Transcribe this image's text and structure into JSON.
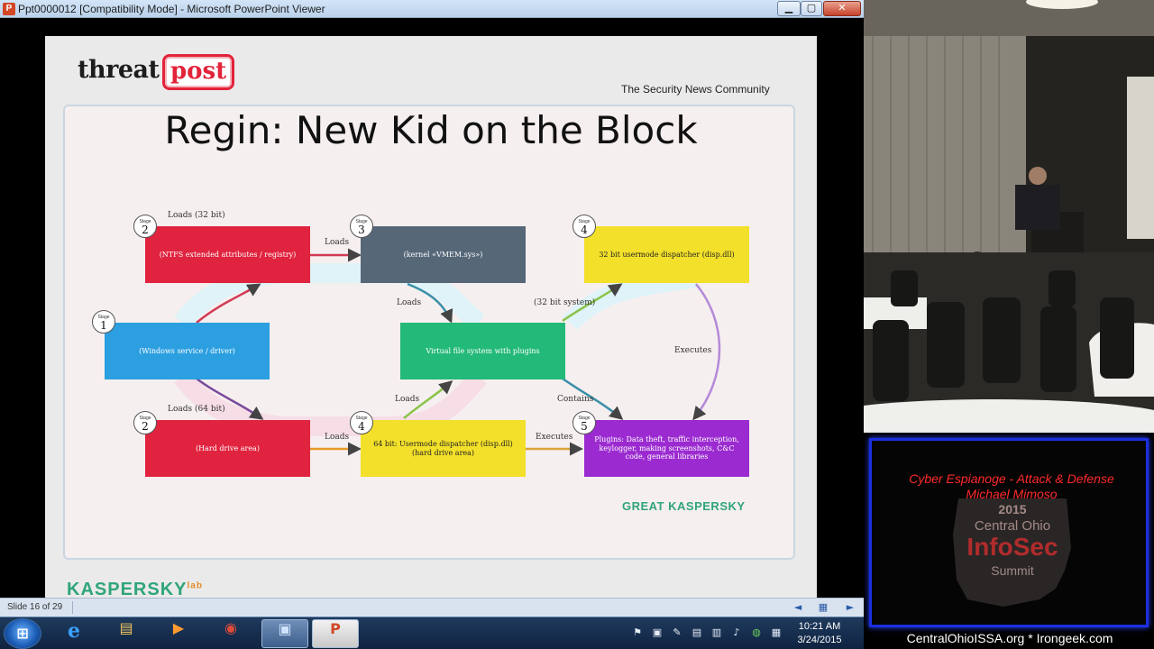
{
  "window": {
    "app_icon": "P",
    "title": "Ppt0000012 [Compatibility Mode] - Microsoft PowerPoint Viewer",
    "min_glyph": "▁",
    "max_glyph": "▢",
    "close_glyph": "✕"
  },
  "slide": {
    "logo_threat": "threat",
    "logo_post": "post",
    "tagline": "The Security News Community",
    "title": "Regin: New Kid on the Block",
    "footer_brand": "KASPERSKY",
    "footer_brand_sup": "lab"
  },
  "diagram": {
    "nodes": [
      {
        "label": "(Windows service / driver)",
        "color": "#2c9fe0"
      },
      {
        "label": "(NTFS extended attributes / registry)",
        "color": "#e0233e"
      },
      {
        "label": "(Hard drive area)",
        "color": "#e0233e"
      },
      {
        "label": "(kernel «VMEM.sys»)",
        "color": "#566778"
      },
      {
        "label": "Virtual file system with plugins",
        "color": "#23b978"
      },
      {
        "label": "64 bit: Usermode dispatcher (disp.dll) (hard drive area)",
        "color": "#f3e02a"
      },
      {
        "label": "32 bit usermode dispatcher (disp.dll)",
        "color": "#f3e02a"
      },
      {
        "label": "Plugins: Data theft, traffic interception, keylogger, making screenshots, C&C code, general libraries",
        "color": "#9b2bd0"
      }
    ],
    "stages": {
      "label": "Stage",
      "one": "1",
      "two_top": "2",
      "two_bottom": "2",
      "three": "3",
      "four_top": "4",
      "four_bottom": "4",
      "five": "5"
    },
    "edge_labels": {
      "loads_32": "Loads (32 bit)",
      "loads_64": "Loads (64 bit)",
      "loads_a": "Loads",
      "loads_b": "Loads",
      "loads_c": "Loads",
      "loads_d": "Loads",
      "system_32": "(32 bit system)",
      "contains": "Contains",
      "executes_a": "Executes",
      "executes_b": "Executes"
    },
    "brand_right": "GREAT  KASPERSKY"
  },
  "statusbar": {
    "slide_counter": "Slide 16 of 29",
    "prev_icon": "◄",
    "slideshow_icon": "▦",
    "next_icon": "►"
  },
  "taskbar": {
    "start_glyph": "⊞",
    "ie_glyph": "e",
    "explorer_glyph": "▤",
    "media_glyph": "▶",
    "chrome_glyph": "◉",
    "remote_glyph": "▣",
    "ppt_glyph": "P",
    "tray_glyphs": [
      "⚑",
      "▣",
      "✎",
      "▤",
      "▥",
      "♪",
      "◍",
      "▦"
    ],
    "time": "10:21 AM",
    "date": "3/24/2015"
  },
  "event": {
    "talk_title": "Cyber Espianoge - Attack & Defense",
    "speaker": "Michael Mimoso",
    "year": "2015",
    "region": "Central Ohio",
    "name": "InfoSec",
    "summit": "Summit",
    "url": "CentralOhioISSA.org * Irongeek.com"
  }
}
